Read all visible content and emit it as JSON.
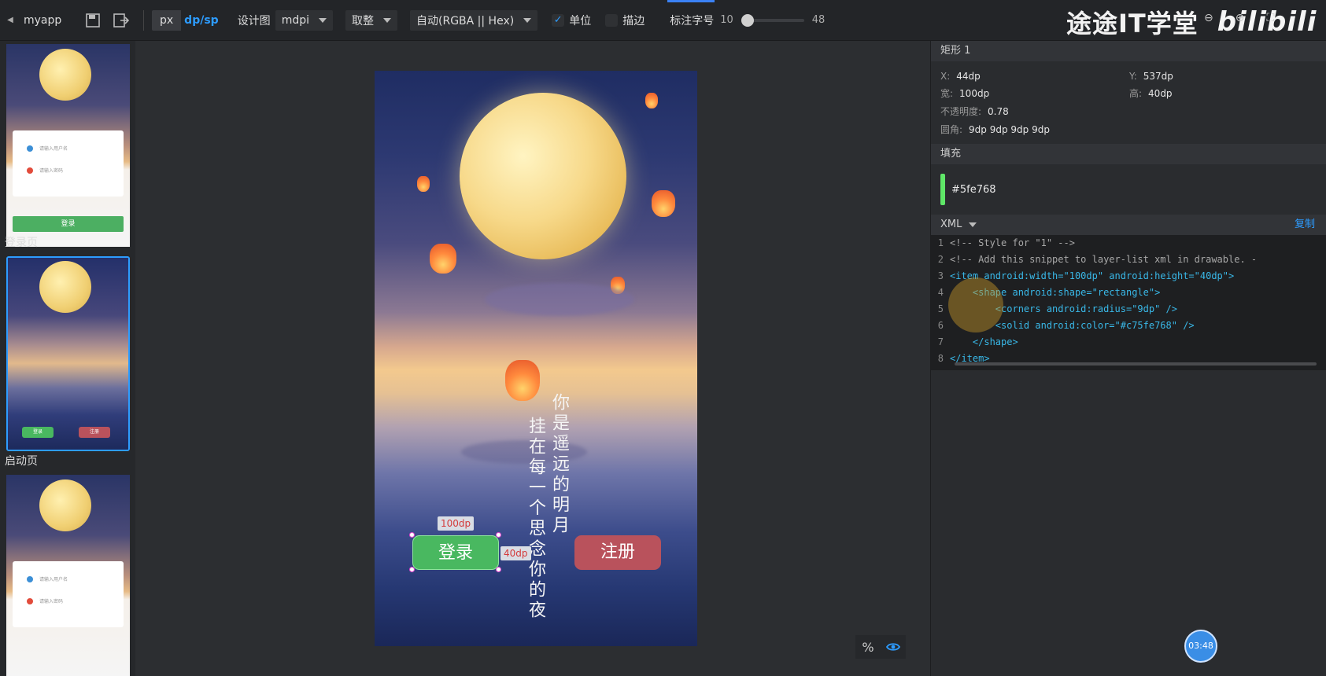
{
  "toolbar": {
    "app_name": "myapp",
    "unit_px": "px",
    "unit_dp": "dp/sp",
    "design_label": "设计图",
    "design_value": "mdpi",
    "color_pick": "取整",
    "color_format": "自动(RGBA || Hex)",
    "unit_checkbox": "单位",
    "stroke_checkbox": "描边",
    "font_size_label": "标注字号",
    "font_size_min": "10",
    "font_size_max": "48"
  },
  "watermark": {
    "text": "途途IT学堂",
    "logo": "bilibili"
  },
  "pages": [
    {
      "label": "登录页",
      "placeholder_user": "请输入用户名",
      "placeholder_pwd": "请输入密码",
      "button": "登录"
    },
    {
      "label": "启动页",
      "button_login": "登录",
      "button_register": "注册"
    },
    {
      "placeholder_user": "请输入用户名",
      "placeholder_pwd": "请输入密码"
    }
  ],
  "canvas": {
    "poem_line1": "你是遥远的明月",
    "poem_line2": "挂在每一个思念你的夜",
    "login_button": "登录",
    "register_button": "注册",
    "width_tag": "100dp",
    "height_tag": "40dp"
  },
  "properties": {
    "title": "矩形 1",
    "x_label": "X:",
    "x_value": "44dp",
    "y_label": "Y:",
    "y_value": "537dp",
    "w_label": "宽:",
    "w_value": "100dp",
    "h_label": "高:",
    "h_value": "40dp",
    "opacity_label": "不透明度:",
    "opacity_value": "0.78",
    "radius_label": "圆角:",
    "radius_value": "9dp 9dp 9dp 9dp"
  },
  "fill": {
    "title": "填充",
    "color_hex": "#5fe768"
  },
  "xml": {
    "title": "XML",
    "copy": "复制",
    "line_numbers": [
      "1",
      "2",
      "3",
      "4",
      "5",
      "6",
      "7",
      "8"
    ],
    "lines": [
      "<!-- Style for \"1\" -->",
      "<!-- Add this snippet to layer-list xml in drawable. -",
      "<item android:width=\"100dp\" android:height=\"40dp\">",
      "    <shape android:shape=\"rectangle\">",
      "        <corners android:radius=\"9dp\" />",
      "        <solid android:color=\"#c75fe768\" />",
      "    </shape>",
      "</item>"
    ]
  },
  "timer": "03:48",
  "colors": {
    "accent": "#2d9cff",
    "fill": "#5fe768",
    "register": "#b9525c"
  }
}
